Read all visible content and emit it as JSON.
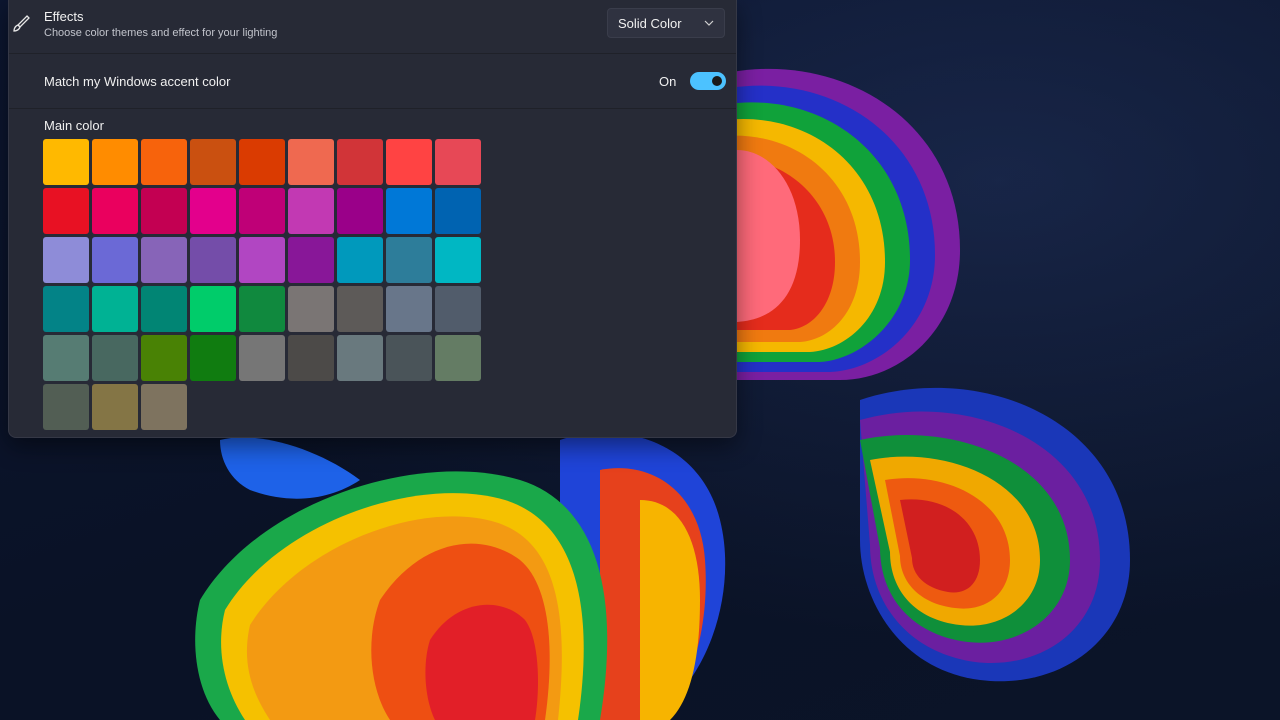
{
  "effects": {
    "title": "Effects",
    "subtitle": "Choose color themes and effect for your lighting",
    "icon": "brush-icon",
    "dropdown_value": "Solid Color",
    "dropdown_icon": "chevron-down-icon"
  },
  "match": {
    "label": "Match my Windows accent color",
    "state_label": "On",
    "enabled": true,
    "toggle_color": "#4cc2ff"
  },
  "main_color": {
    "label": "Main color",
    "swatches": [
      "#FFB900",
      "#FF8C00",
      "#F7630C",
      "#CA5010",
      "#DA3B01",
      "#EF6950",
      "#D13438",
      "#FF4343",
      "#E74856",
      "#E81123",
      "#EA005E",
      "#C30052",
      "#E3008C",
      "#BF0077",
      "#C239B3",
      "#9A0089",
      "#0078D7",
      "#0063B1",
      "#8E8CD8",
      "#6B69D6",
      "#8764B8",
      "#744DA9",
      "#B146C2",
      "#881798",
      "#0099BC",
      "#2D7D9A",
      "#00B7C3",
      "#038387",
      "#00B294",
      "#018574",
      "#00CC6A",
      "#10893E",
      "#7A7574",
      "#5D5A58",
      "#68768A",
      "#515C6B",
      "#567C73",
      "#486860",
      "#498205",
      "#107C10",
      "#767676",
      "#4C4A48",
      "#69797E",
      "#4A5459",
      "#647C64",
      "#525E54",
      "#847545",
      "#7E735F"
    ]
  }
}
